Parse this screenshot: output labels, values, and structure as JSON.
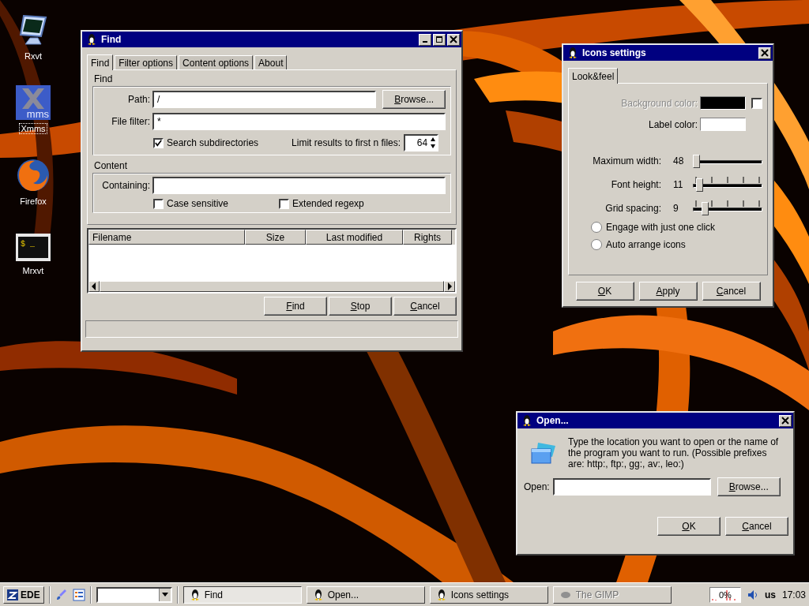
{
  "desktop_icons": [
    {
      "kind": "monitor",
      "label": "Rxvt",
      "selected": false
    },
    {
      "kind": "xmms",
      "label": "Xmms",
      "logo_text": "mms",
      "selected": true
    },
    {
      "kind": "globe",
      "label": "Firefox",
      "selected": false
    },
    {
      "kind": "terminal",
      "label": "Mrxvt",
      "prompt": "$ _",
      "selected": false
    }
  ],
  "find_window": {
    "title": "Find",
    "tabs": [
      {
        "label": "Find",
        "selected": true
      },
      {
        "label": "Filter options",
        "selected": false
      },
      {
        "label": "Content options",
        "selected": false
      },
      {
        "label": "About",
        "selected": false
      }
    ],
    "find_group": {
      "title": "Find",
      "path_label": "Path:",
      "path_value": "/",
      "browse": "Browse...",
      "filter_label": "File filter:",
      "filter_value": "*",
      "subdirs": {
        "label": "Search subdirectories",
        "checked": true
      },
      "limit_label": "Limit results to first n files:",
      "limit_value": "64"
    },
    "content_group": {
      "title": "Content",
      "containing_label": "Containing:",
      "options": [
        {
          "label": "Case sensitive",
          "checked": false
        },
        {
          "label": "Extended regexp",
          "checked": false
        }
      ]
    },
    "table": {
      "columns": [
        "Filename",
        "Size",
        "Last modified",
        "Rights"
      ]
    },
    "buttons": [
      "Find",
      "Stop",
      "Cancel"
    ]
  },
  "icons_window": {
    "title": "Icons settings",
    "tabs": [
      {
        "label": "Look&feel",
        "selected": true
      }
    ],
    "background": {
      "label": "Background color:",
      "disabled": true,
      "color": "#000000",
      "checked": false
    },
    "label_color": {
      "label": "Label color:",
      "color": "#ffffff"
    },
    "sliders": [
      {
        "label": "Maximum width:",
        "reading": "48",
        "level": 0,
        "ticks": false
      },
      {
        "label": "Font height:",
        "reading": "11",
        "level": 0.05,
        "ticks": true
      },
      {
        "label": "Grid spacing:",
        "reading": "9",
        "level": 0.15,
        "ticks": true
      }
    ],
    "radios": [
      {
        "label": "Engage with just one click",
        "selected": false
      },
      {
        "label": "Auto arrange icons",
        "selected": false
      }
    ],
    "buttons": [
      "OK",
      "Apply",
      "Cancel"
    ]
  },
  "open_window": {
    "title": "Open...",
    "message": "Type the location you want to open or the name of the program you want to run. (Possible prefixes are: http:, ftp:, gg:, av:, leo:)",
    "open_label": "Open:",
    "browse": "Browse...",
    "buttons": [
      "OK",
      "Cancel"
    ]
  },
  "taskbar": {
    "start": "EDE",
    "tasks": [
      {
        "label": "Find",
        "selected": true,
        "disabled": false
      },
      {
        "label": "Open...",
        "selected": false,
        "disabled": false
      },
      {
        "label": "Icons settings",
        "selected": false,
        "disabled": false
      },
      {
        "label": "The GIMP",
        "selected": false,
        "disabled": true
      }
    ],
    "cpu": "0%",
    "layout": "us",
    "clock": "17:03"
  }
}
